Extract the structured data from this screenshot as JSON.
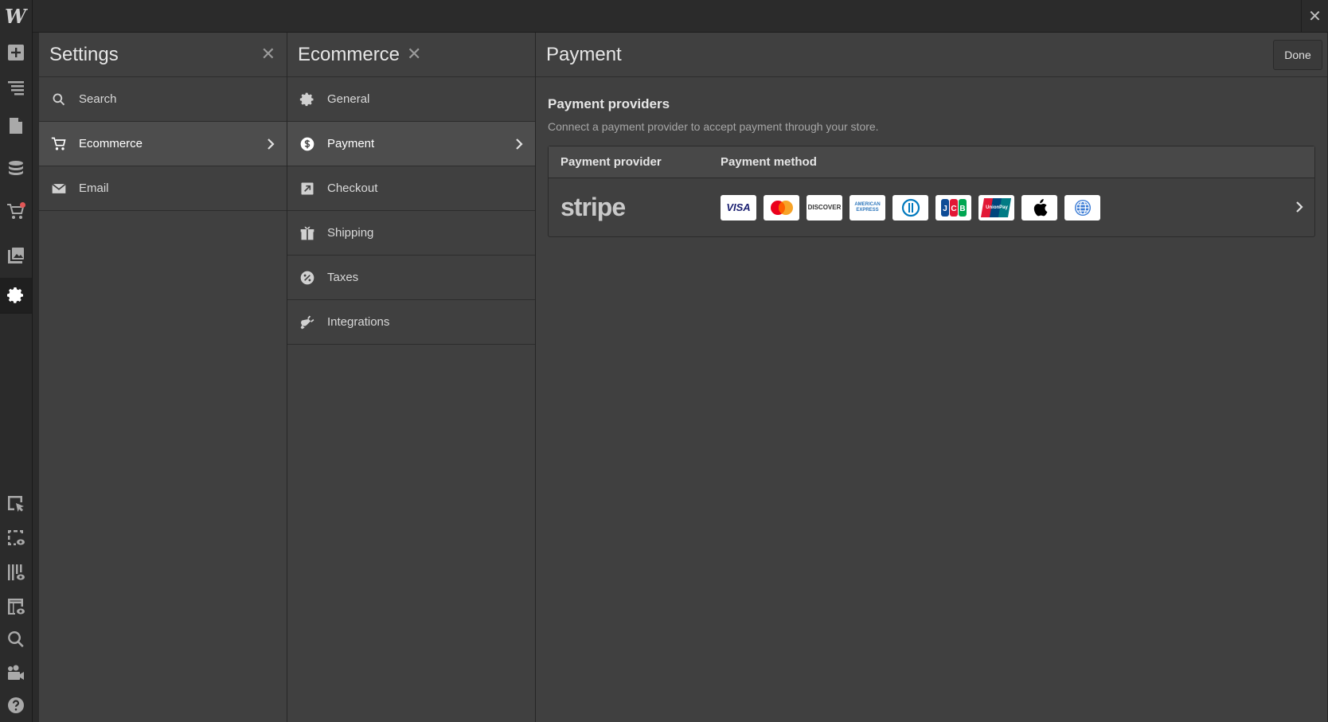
{
  "rail": {
    "logo": "W",
    "items": [
      {
        "name": "add-icon"
      },
      {
        "name": "navigator-icon"
      },
      {
        "name": "pages-icon"
      },
      {
        "name": "cms-icon"
      },
      {
        "name": "ecommerce-cart-icon"
      },
      {
        "name": "assets-icon"
      },
      {
        "name": "settings-gear-icon"
      }
    ],
    "bottom_items": [
      {
        "name": "select-tool-icon"
      },
      {
        "name": "preview-selection-icon"
      },
      {
        "name": "audit-icon"
      },
      {
        "name": "layout-preview-icon"
      },
      {
        "name": "search-icon"
      },
      {
        "name": "video-icon"
      },
      {
        "name": "help-icon"
      }
    ]
  },
  "settings_panel": {
    "title": "Settings",
    "items": [
      {
        "label": "Search",
        "icon": "search-icon"
      },
      {
        "label": "Ecommerce",
        "icon": "cart-icon",
        "selected": true
      },
      {
        "label": "Email",
        "icon": "mail-icon"
      }
    ]
  },
  "ecommerce_panel": {
    "title": "Ecommerce",
    "items": [
      {
        "label": "General",
        "icon": "gear-icon"
      },
      {
        "label": "Payment",
        "icon": "dollar-icon",
        "selected": true
      },
      {
        "label": "Checkout",
        "icon": "checkout-arrow-icon"
      },
      {
        "label": "Shipping",
        "icon": "package-icon"
      },
      {
        "label": "Taxes",
        "icon": "percent-icon"
      },
      {
        "label": "Integrations",
        "icon": "plug-icon"
      }
    ]
  },
  "payment_panel": {
    "title": "Payment",
    "done_label": "Done",
    "section_title": "Payment providers",
    "section_desc": "Connect a payment provider to accept payment through your store.",
    "table": {
      "headers": [
        "Payment provider",
        "Payment method"
      ],
      "rows": [
        {
          "provider": "stripe",
          "methods": [
            "VISA",
            "mastercard",
            "DISCOVER",
            "AMERICAN EXPRESS",
            "diners-club",
            "JCB",
            "UnionPay",
            "apple-pay",
            "web-payments"
          ]
        }
      ]
    }
  },
  "colors": {
    "panel_bg": "#404040",
    "frame_bg": "#2b2b2b",
    "selected_row": "#4d4d4d",
    "notification_dot": "#e25757"
  }
}
